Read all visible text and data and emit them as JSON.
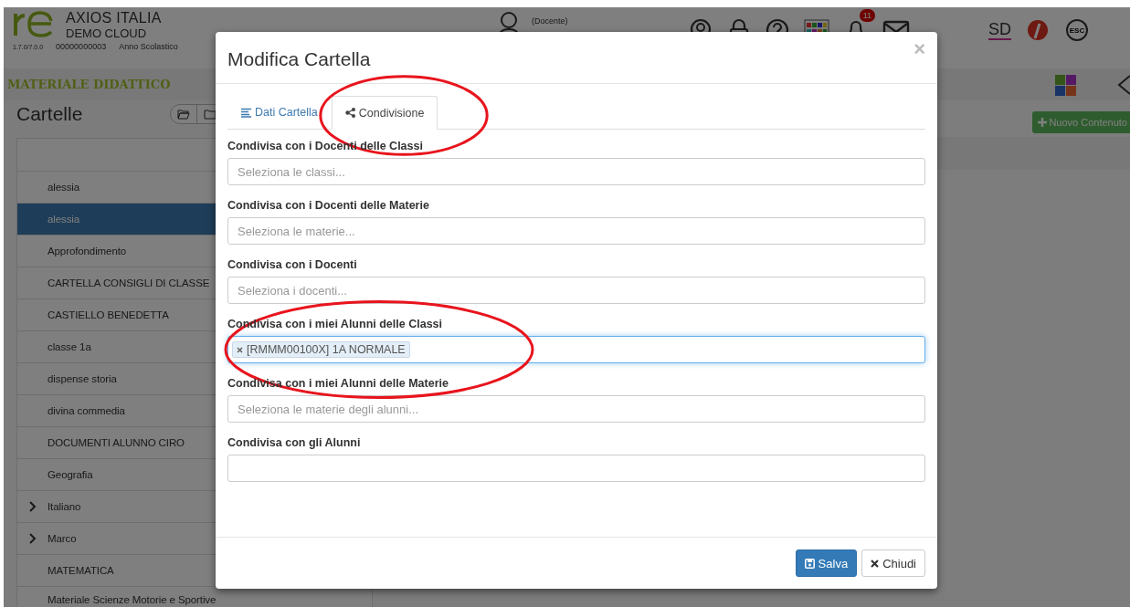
{
  "header": {
    "school": "AXIOS ITALIA",
    "subtitle": "DEMO CLOUD",
    "version": "1.7.0/7.0.0",
    "code": "00000000003",
    "year_label": "Anno Scolastico",
    "role": "(Docente)",
    "notification_count": "11",
    "sd_logo": "SD",
    "esc": "ESC"
  },
  "menu": {
    "title": "MATERIALE DIDATTICO"
  },
  "sidebar": {
    "title": "Cartelle",
    "items": [
      {
        "label": "alessia",
        "selected": false,
        "kind": "leaf"
      },
      {
        "label": "alessia",
        "selected": true,
        "kind": "leaf"
      },
      {
        "label": "Approfondimento",
        "selected": false,
        "kind": "leaf"
      },
      {
        "label": "CARTELLA CONSIGLI DI CLASSE",
        "selected": false,
        "kind": "leaf"
      },
      {
        "label": "CASTIELLO BENEDETTA",
        "selected": false,
        "kind": "leaf"
      },
      {
        "label": "classe 1a",
        "selected": false,
        "kind": "leaf"
      },
      {
        "label": "dispense storia",
        "selected": false,
        "kind": "leaf"
      },
      {
        "label": "divina commedia",
        "selected": false,
        "kind": "leaf"
      },
      {
        "label": "DOCUMENTI ALUNNO CIRO",
        "selected": false,
        "kind": "leaf"
      },
      {
        "label": "Geografia",
        "selected": false,
        "kind": "leaf"
      },
      {
        "label": "Italiano",
        "selected": false,
        "kind": "group"
      },
      {
        "label": "Marco",
        "selected": false,
        "kind": "group"
      },
      {
        "label": "MATEMATICA",
        "selected": false,
        "kind": "leaf"
      },
      {
        "label": "Materiale Scienze Motorie e Sportive",
        "selected": false,
        "kind": "leaf"
      }
    ]
  },
  "new_button": "Nuovo Contenuto",
  "modal": {
    "title": "Modifica Cartella",
    "close": "×",
    "tabs": [
      {
        "label": "Dati Cartella",
        "kind": "details",
        "selected": false,
        "circled": false
      },
      {
        "label": "Condivisione",
        "kind": "share",
        "selected": true,
        "circled": true
      }
    ],
    "fields": [
      {
        "label": "Condivisa con i Docenti delle Classi",
        "placeholder": "Seleziona le classi...",
        "focused": false,
        "circled": false
      },
      {
        "label": "Condivisa con i Docenti delle Materie",
        "placeholder": "Seleziona le materie...",
        "focused": false,
        "circled": false
      },
      {
        "label": "Condivisa con i Docenti",
        "placeholder": "Seleziona i docenti...",
        "focused": false,
        "circled": false
      },
      {
        "label": "Condivisa con i miei Alunni delle Classi",
        "tags": [
          "[RMMM00100X] 1A NORMALE"
        ],
        "focused": true,
        "circled": true
      },
      {
        "label": "Condivisa con i miei Alunni delle Materie",
        "placeholder": "Seleziona le materie degli alunni...",
        "focused": false,
        "circled": false
      },
      {
        "label": "Condivisa con gli Alunni",
        "focused": false,
        "circled": false
      }
    ],
    "buttons": [
      {
        "label": "Salva",
        "kind": "primary"
      },
      {
        "label": "Chiudi",
        "kind": "default"
      }
    ]
  }
}
